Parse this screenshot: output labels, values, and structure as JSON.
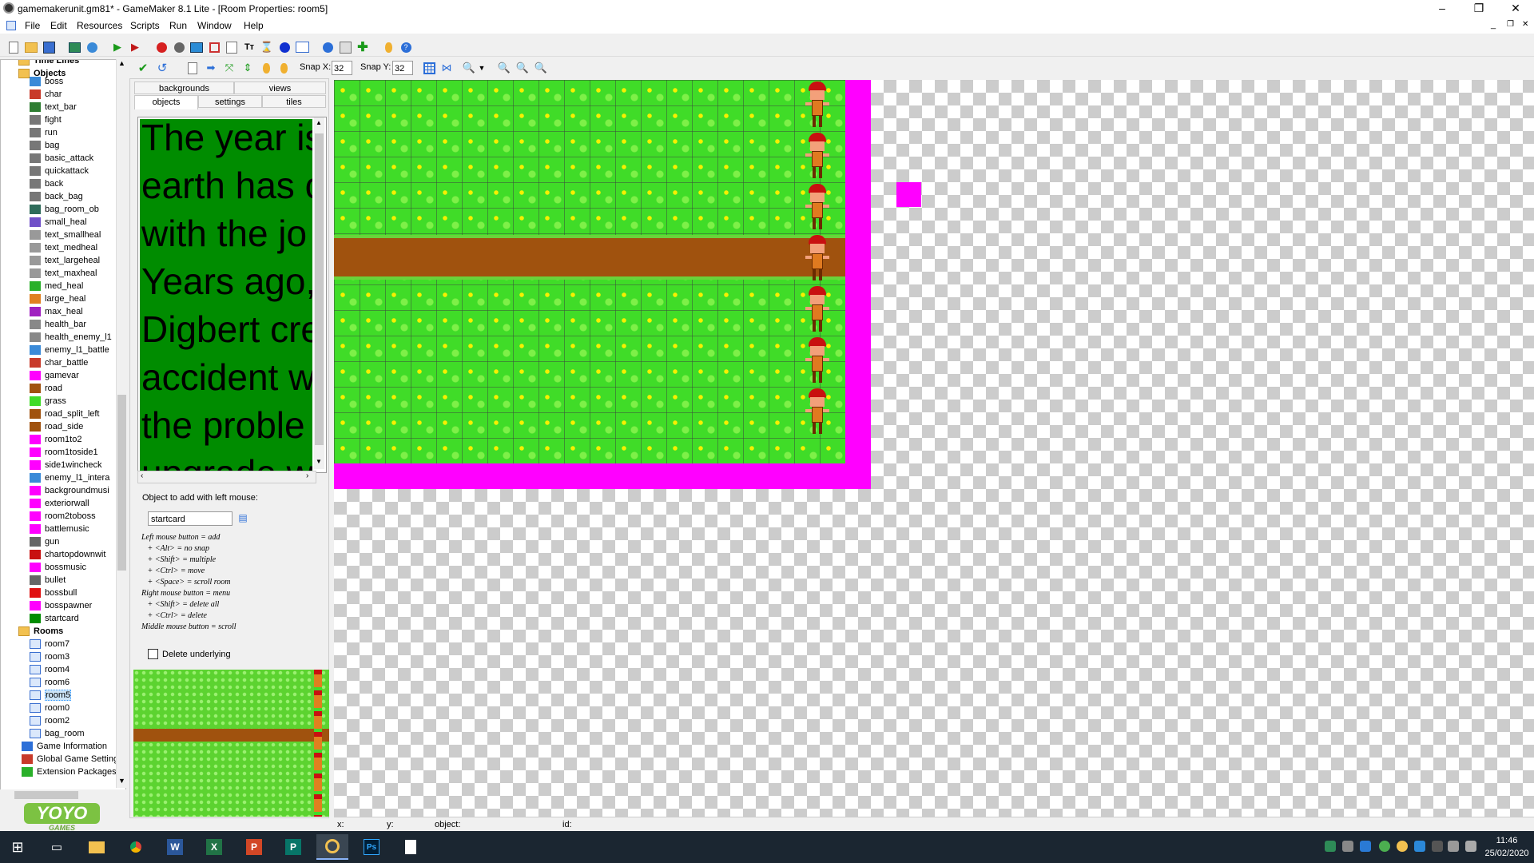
{
  "window": {
    "title": "gamemakerunit.gm81* - GameMaker 8.1 Lite - [Room Properties: room5]",
    "minimize": "–",
    "restore": "❐",
    "close": "✕"
  },
  "menu": [
    "File",
    "Edit",
    "Resources",
    "Scripts",
    "Run",
    "Window",
    "Help"
  ],
  "room_toolbar": {
    "snap_x_label": "Snap X:",
    "snap_x_value": "32",
    "snap_y_label": "Snap Y:",
    "snap_y_value": "32"
  },
  "tree": {
    "timelines": "Time Lines",
    "objects_folder": "Objects",
    "objects": [
      "boss",
      "char",
      "text_bar",
      "fight",
      "run",
      "bag",
      "basic_attack",
      "quickattack",
      "back",
      "back_bag",
      "bag_room_ob",
      "small_heal",
      "text_smallheal",
      "text_medheal",
      "text_largeheal",
      "text_maxheal",
      "med_heal",
      "large_heal",
      "max_heal",
      "health_bar",
      "health_enemy_l1",
      "enemy_l1_battle",
      "char_battle",
      "gamevar",
      "road",
      "grass",
      "road_split_left",
      "road_side",
      "room1to2",
      "room1toside1",
      "side1wincheck",
      "enemy_l1_intera",
      "backgroundmusi",
      "exteriorwall",
      "room2toboss",
      "battlemusic",
      "gun",
      "chartopdownwit",
      "bossmusic",
      "bullet",
      "bossbull",
      "bosspawner",
      "startcard"
    ],
    "rooms_folder": "Rooms",
    "rooms": [
      "room7",
      "room3",
      "room4",
      "room6",
      "room5",
      "room0",
      "room2",
      "bag_room"
    ],
    "selected_room": "room5",
    "extras": [
      "Game Information",
      "Global Game Setting",
      "Extension Packages"
    ]
  },
  "logo": {
    "top": "YOYO",
    "bottom": "GAMES"
  },
  "tabs": {
    "row1": [
      "backgrounds",
      "views"
    ],
    "row2": [
      "objects",
      "settings",
      "tiles"
    ],
    "active": "objects"
  },
  "object_preview_text": [
    "The year is",
    "earth has c",
    "with the jo",
    "Years ago,",
    "Digbert cre",
    "accident w",
    "the proble",
    "upgrade w"
  ],
  "object_panel": {
    "label": "Object to add with left mouse:",
    "value": "startcard",
    "help": "Left mouse button = add\n   + <Alt> = no snap\n   + <Shift> = multiple\n   + <Ctrl> = move\n   + <Space> = scroll room\nRight mouse button = menu\n   + <Shift> = delete all\n   + <Ctrl> = delete\nMiddle mouse button = scroll",
    "delete_underlying": "Delete underlying"
  },
  "status": {
    "x": "x:",
    "y": "y:",
    "object": "object:",
    "id": "id:"
  },
  "clock": {
    "time": "11:46",
    "date": "25/02/2020"
  },
  "colors": {
    "magenta": "#ff00ff",
    "grass": "#40dc28",
    "road": "#a0520e",
    "taskbar": "#1b2631"
  }
}
